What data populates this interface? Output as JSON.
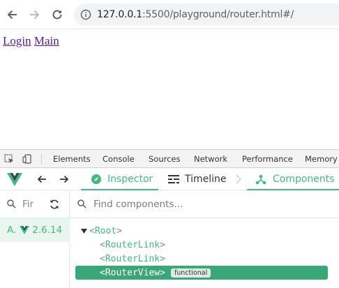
{
  "browser": {
    "url_host": "127.0.0.1",
    "url_rest": ":5500/playground/router.html#/"
  },
  "page": {
    "links": [
      "Login",
      "Main"
    ]
  },
  "devtools": {
    "tabs": [
      "Elements",
      "Console",
      "Sources",
      "Network",
      "Performance",
      "Memory"
    ]
  },
  "vue": {
    "inspector_label": "Inspector",
    "timeline_label": "Timeline",
    "components_label": "Components",
    "filter_placeholder": "Fir",
    "app_label": "A.",
    "app_version": "2.6.14",
    "find_placeholder": "Find components...",
    "tree": [
      {
        "name": "Root",
        "depth": 0,
        "expanded": true
      },
      {
        "name": "RouterLink",
        "depth": 1
      },
      {
        "name": "RouterLink",
        "depth": 1
      },
      {
        "name": "RouterView",
        "depth": 1,
        "selected": true,
        "badge": "functional"
      }
    ],
    "accent_color": "#42b883"
  }
}
